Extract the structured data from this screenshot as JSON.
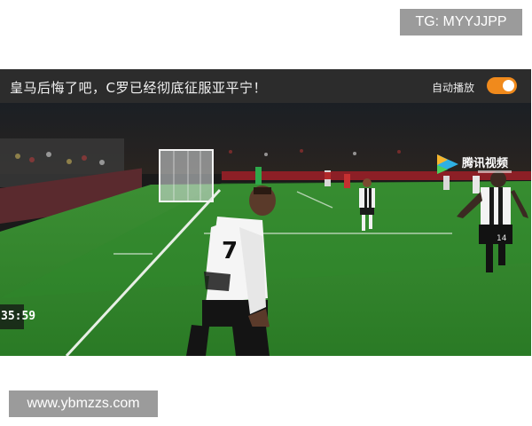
{
  "watermarks": {
    "top": "TG: MYYJJPP",
    "bottom": "www.ybmzzs.com"
  },
  "player": {
    "title": "皇马后悔了吧，C罗已经彻底征服亚平宁！",
    "autoplay_label": "自动播放",
    "autoplay_on": true,
    "toggle_color": "#f08a1c",
    "channel_name": "腾讯视频",
    "channel_icon": "play-logo-icon",
    "match_clock": "35:59",
    "jersey_number_left": "7",
    "jersey_number_right": "14"
  },
  "colors": {
    "header_bg": "#2c2c2c",
    "pitch_green": "#2f8a2b",
    "watermark_bg": "#9b9b9b"
  }
}
